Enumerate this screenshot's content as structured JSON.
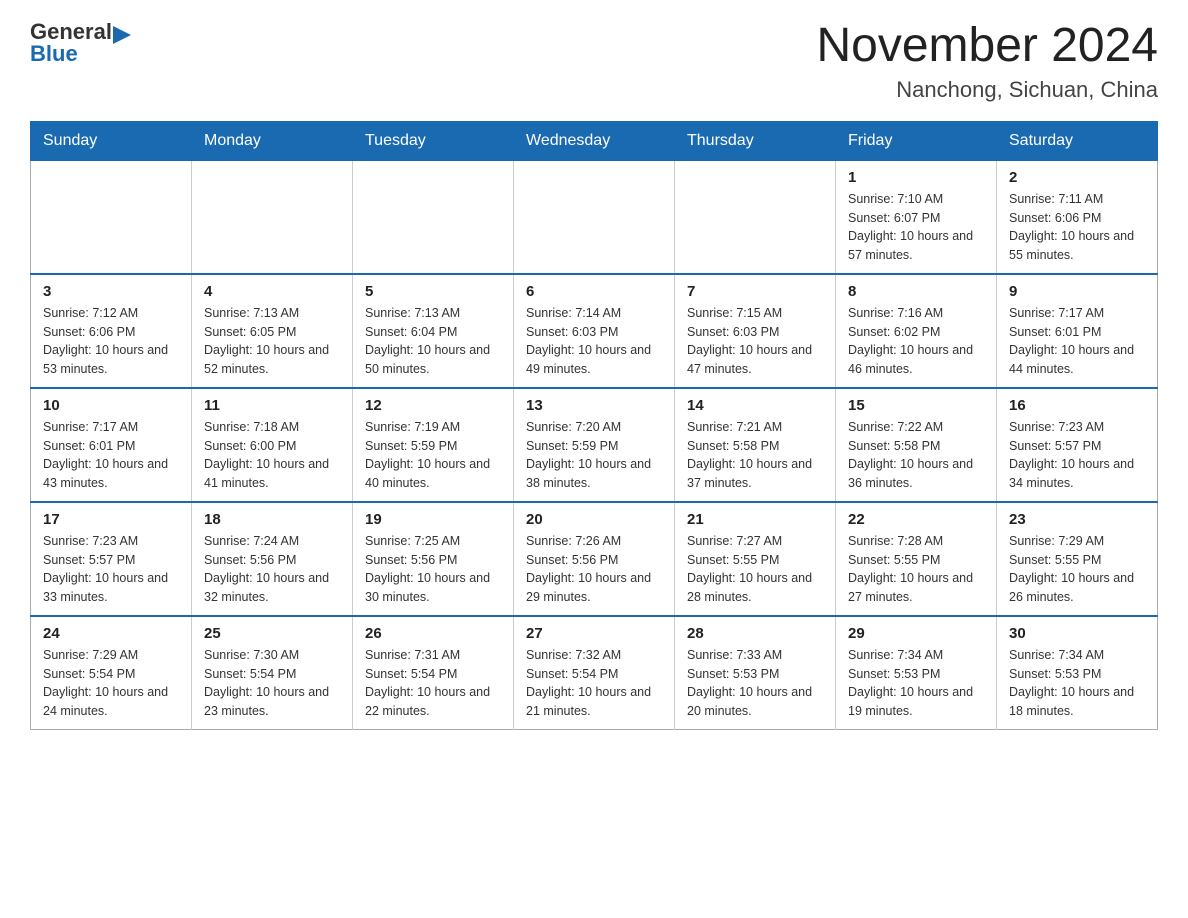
{
  "header": {
    "logo": {
      "general": "General",
      "blue": "Blue",
      "aria": "GeneralBlue logo"
    },
    "title": "November 2024",
    "subtitle": "Nanchong, Sichuan, China"
  },
  "calendar": {
    "days_of_week": [
      "Sunday",
      "Monday",
      "Tuesday",
      "Wednesday",
      "Thursday",
      "Friday",
      "Saturday"
    ],
    "weeks": [
      [
        {
          "day": "",
          "info": ""
        },
        {
          "day": "",
          "info": ""
        },
        {
          "day": "",
          "info": ""
        },
        {
          "day": "",
          "info": ""
        },
        {
          "day": "",
          "info": ""
        },
        {
          "day": "1",
          "info": "Sunrise: 7:10 AM\nSunset: 6:07 PM\nDaylight: 10 hours and 57 minutes."
        },
        {
          "day": "2",
          "info": "Sunrise: 7:11 AM\nSunset: 6:06 PM\nDaylight: 10 hours and 55 minutes."
        }
      ],
      [
        {
          "day": "3",
          "info": "Sunrise: 7:12 AM\nSunset: 6:06 PM\nDaylight: 10 hours and 53 minutes."
        },
        {
          "day": "4",
          "info": "Sunrise: 7:13 AM\nSunset: 6:05 PM\nDaylight: 10 hours and 52 minutes."
        },
        {
          "day": "5",
          "info": "Sunrise: 7:13 AM\nSunset: 6:04 PM\nDaylight: 10 hours and 50 minutes."
        },
        {
          "day": "6",
          "info": "Sunrise: 7:14 AM\nSunset: 6:03 PM\nDaylight: 10 hours and 49 minutes."
        },
        {
          "day": "7",
          "info": "Sunrise: 7:15 AM\nSunset: 6:03 PM\nDaylight: 10 hours and 47 minutes."
        },
        {
          "day": "8",
          "info": "Sunrise: 7:16 AM\nSunset: 6:02 PM\nDaylight: 10 hours and 46 minutes."
        },
        {
          "day": "9",
          "info": "Sunrise: 7:17 AM\nSunset: 6:01 PM\nDaylight: 10 hours and 44 minutes."
        }
      ],
      [
        {
          "day": "10",
          "info": "Sunrise: 7:17 AM\nSunset: 6:01 PM\nDaylight: 10 hours and 43 minutes."
        },
        {
          "day": "11",
          "info": "Sunrise: 7:18 AM\nSunset: 6:00 PM\nDaylight: 10 hours and 41 minutes."
        },
        {
          "day": "12",
          "info": "Sunrise: 7:19 AM\nSunset: 5:59 PM\nDaylight: 10 hours and 40 minutes."
        },
        {
          "day": "13",
          "info": "Sunrise: 7:20 AM\nSunset: 5:59 PM\nDaylight: 10 hours and 38 minutes."
        },
        {
          "day": "14",
          "info": "Sunrise: 7:21 AM\nSunset: 5:58 PM\nDaylight: 10 hours and 37 minutes."
        },
        {
          "day": "15",
          "info": "Sunrise: 7:22 AM\nSunset: 5:58 PM\nDaylight: 10 hours and 36 minutes."
        },
        {
          "day": "16",
          "info": "Sunrise: 7:23 AM\nSunset: 5:57 PM\nDaylight: 10 hours and 34 minutes."
        }
      ],
      [
        {
          "day": "17",
          "info": "Sunrise: 7:23 AM\nSunset: 5:57 PM\nDaylight: 10 hours and 33 minutes."
        },
        {
          "day": "18",
          "info": "Sunrise: 7:24 AM\nSunset: 5:56 PM\nDaylight: 10 hours and 32 minutes."
        },
        {
          "day": "19",
          "info": "Sunrise: 7:25 AM\nSunset: 5:56 PM\nDaylight: 10 hours and 30 minutes."
        },
        {
          "day": "20",
          "info": "Sunrise: 7:26 AM\nSunset: 5:56 PM\nDaylight: 10 hours and 29 minutes."
        },
        {
          "day": "21",
          "info": "Sunrise: 7:27 AM\nSunset: 5:55 PM\nDaylight: 10 hours and 28 minutes."
        },
        {
          "day": "22",
          "info": "Sunrise: 7:28 AM\nSunset: 5:55 PM\nDaylight: 10 hours and 27 minutes."
        },
        {
          "day": "23",
          "info": "Sunrise: 7:29 AM\nSunset: 5:55 PM\nDaylight: 10 hours and 26 minutes."
        }
      ],
      [
        {
          "day": "24",
          "info": "Sunrise: 7:29 AM\nSunset: 5:54 PM\nDaylight: 10 hours and 24 minutes."
        },
        {
          "day": "25",
          "info": "Sunrise: 7:30 AM\nSunset: 5:54 PM\nDaylight: 10 hours and 23 minutes."
        },
        {
          "day": "26",
          "info": "Sunrise: 7:31 AM\nSunset: 5:54 PM\nDaylight: 10 hours and 22 minutes."
        },
        {
          "day": "27",
          "info": "Sunrise: 7:32 AM\nSunset: 5:54 PM\nDaylight: 10 hours and 21 minutes."
        },
        {
          "day": "28",
          "info": "Sunrise: 7:33 AM\nSunset: 5:53 PM\nDaylight: 10 hours and 20 minutes."
        },
        {
          "day": "29",
          "info": "Sunrise: 7:34 AM\nSunset: 5:53 PM\nDaylight: 10 hours and 19 minutes."
        },
        {
          "day": "30",
          "info": "Sunrise: 7:34 AM\nSunset: 5:53 PM\nDaylight: 10 hours and 18 minutes."
        }
      ]
    ]
  }
}
